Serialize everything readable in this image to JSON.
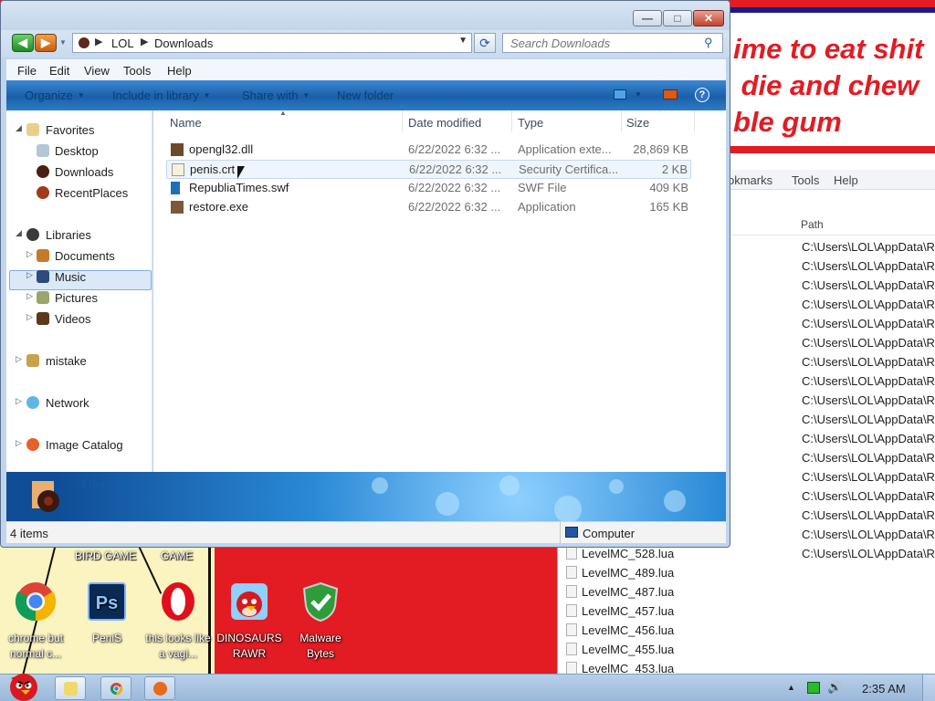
{
  "explorer": {
    "breadcrumb": [
      "LOL",
      "Downloads"
    ],
    "search_placeholder": "Search Downloads",
    "menu": [
      "File",
      "Edit",
      "View",
      "Tools",
      "Help"
    ],
    "commands": [
      "Organize",
      "Include in library",
      "Share with",
      "New folder"
    ],
    "help_glyph": "?",
    "nav": {
      "favorites": "Favorites",
      "desktop": "Desktop",
      "downloads": "Downloads",
      "recent_places": "RecentPlaces",
      "libraries": "Libraries",
      "documents": "Documents",
      "music": "Music",
      "pictures": "Pictures",
      "videos": "Videos",
      "mistake": "mistake",
      "network": "Network",
      "image_catalog": "Image Catalog"
    },
    "columns": {
      "name": "Name",
      "date": "Date modified",
      "type": "Type",
      "size": "Size"
    },
    "files": [
      {
        "name": "opengl32.dll",
        "date": "6/22/2022 6:32 ...",
        "type": "Application exte...",
        "size": "28,869 KB",
        "icon": "dll-icon"
      },
      {
        "name": "penis.crt",
        "date": "6/22/2022 6:32 ...",
        "type": "Security Certifica...",
        "size": "2 KB",
        "icon": "certificate-icon"
      },
      {
        "name": "RepubliaTimes.swf",
        "date": "6/22/2022 6:32 ...",
        "type": "SWF File",
        "size": "409 KB",
        "icon": "swf-icon"
      },
      {
        "name": "restore.exe",
        "date": "6/22/2022 6:32 ...",
        "type": "Application",
        "size": "165 KB",
        "icon": "exe-icon"
      }
    ],
    "details_text": "4 items",
    "status_left": "4 items",
    "status_right": "Computer",
    "window_buttons": {
      "minimize": "—",
      "maximize": "□",
      "close": "✕"
    }
  },
  "background": {
    "meme_text": "ime to eat shit\n die and chew\nble gum",
    "bg_menu": [
      "okmarks",
      "Tools",
      "Help"
    ],
    "path_header": "Path",
    "path_rows": [
      "C:\\Users\\LOL\\AppData\\R",
      "C:\\Users\\LOL\\AppData\\R",
      "C:\\Users\\LOL\\AppData\\R",
      "C:\\Users\\LOL\\AppData\\R",
      "C:\\Users\\LOL\\AppData\\R",
      "C:\\Users\\LOL\\AppData\\R",
      "C:\\Users\\LOL\\AppData\\R",
      "C:\\Users\\LOL\\AppData\\R",
      "C:\\Users\\LOL\\AppData\\R",
      "C:\\Users\\LOL\\AppData\\R",
      "C:\\Users\\LOL\\AppData\\R",
      "C:\\Users\\LOL\\AppData\\R",
      "C:\\Users\\LOL\\AppData\\R",
      "C:\\Users\\LOL\\AppData\\R",
      "C:\\Users\\LOL\\AppData\\R",
      "C:\\Users\\LOL\\AppData\\R",
      "C:\\Users\\LOL\\AppData\\R"
    ],
    "lua_files": [
      "LevelMC_528.lua",
      "LevelMC_489.lua",
      "LevelMC_487.lua",
      "LevelMC_457.lua",
      "LevelMC_456.lua",
      "LevelMC_455.lua",
      "LevelMC_453.lua"
    ],
    "desk_labels": [
      "BIRD GAME",
      "GAME"
    ]
  },
  "desktop_icons": [
    {
      "label": "chrome but normal c...",
      "icon": "chrome-icon"
    },
    {
      "label": "PeniS",
      "icon": "photoshop-icon"
    },
    {
      "label": "this looks like a vagi...",
      "icon": "opera-icon"
    },
    {
      "label": "DINOSAURS RAWR",
      "icon": "angry-birds-icon"
    },
    {
      "label": "Malware Bytes",
      "icon": "malwarebytes-icon"
    }
  ],
  "taskbar": {
    "clock": "2:35 AM",
    "tray_up_glyph": "▲",
    "tray_volume_glyph": "🔊",
    "buttons": [
      "explorer-icon",
      "chrome-icon",
      "search-tool-icon"
    ]
  },
  "colors": {
    "desktop_red": "#e31b23",
    "command_bar_blue": "#1a5fa8",
    "selection": "#dbe8f8"
  }
}
